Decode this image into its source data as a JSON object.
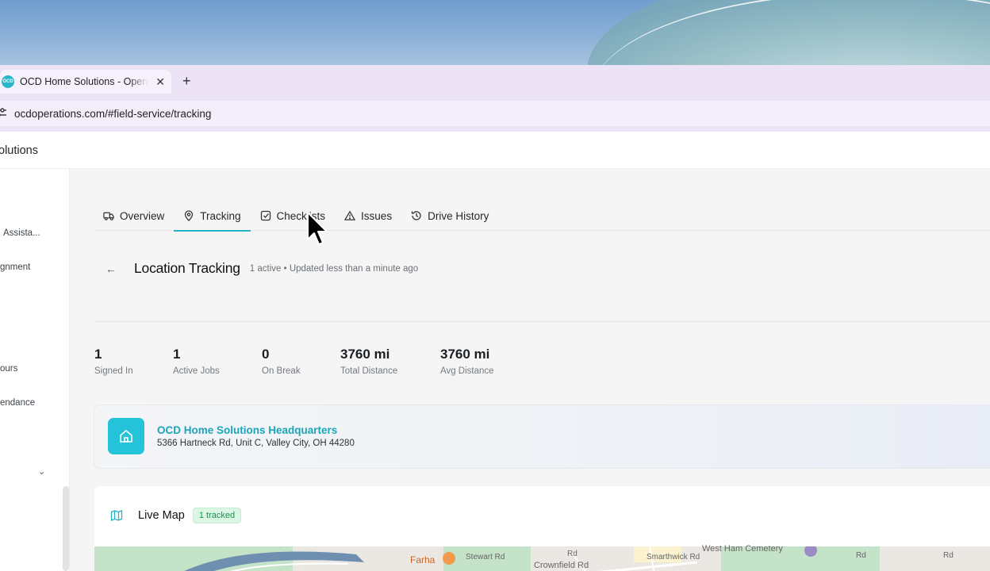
{
  "browser": {
    "tab": {
      "title": "OCD Home Solutions - Operations",
      "favicon_text": "OCD"
    },
    "new_tab_label": "+",
    "close_label": "✕",
    "url": "ocdoperations.com/#field-service/tracking"
  },
  "app": {
    "brand": "olutions"
  },
  "sidebar": {
    "items": [
      {
        "label": "Assista..."
      },
      {
        "label": "gnment"
      },
      {
        "label": "ours"
      },
      {
        "label": "endance"
      }
    ],
    "chevron": "⌄"
  },
  "tabs": [
    {
      "label": "Overview",
      "icon": "truck-icon",
      "active": false
    },
    {
      "label": "Tracking",
      "icon": "map-pin-icon",
      "active": true
    },
    {
      "label": "Checklists",
      "icon": "checkbox-icon",
      "active": false
    },
    {
      "label": "Issues",
      "icon": "warning-icon",
      "active": false
    },
    {
      "label": "Drive History",
      "icon": "history-icon",
      "active": false
    }
  ],
  "page": {
    "back": "←",
    "title": "Location Tracking",
    "subtitle": "1 active • Updated less than a minute ago"
  },
  "stats": [
    {
      "value": "1",
      "label": "Signed In"
    },
    {
      "value": "1",
      "label": "Active Jobs"
    },
    {
      "value": "0",
      "label": "On Break"
    },
    {
      "value": "3760 mi",
      "label": "Total Distance"
    },
    {
      "value": "3760 mi",
      "label": "Avg Distance"
    }
  ],
  "headquarters": {
    "name": "OCD Home Solutions Headquarters",
    "address": "5366 Hartneck Rd, Unit C, Valley City, OH 44280",
    "icon": "home-icon"
  },
  "live_map": {
    "title": "Live Map",
    "badge": "1 tracked",
    "icon": "map-icon",
    "labels": [
      "Farha",
      "Stewart Rd",
      "Crownfield Rd",
      "Smarthwick Rd",
      "West Ham Cemetery",
      "Rd",
      "Rd",
      "Rd"
    ]
  },
  "colors": {
    "accent": "#25b3c8",
    "badge_green": "#19934a",
    "tab_strip": "#ece3f7"
  }
}
